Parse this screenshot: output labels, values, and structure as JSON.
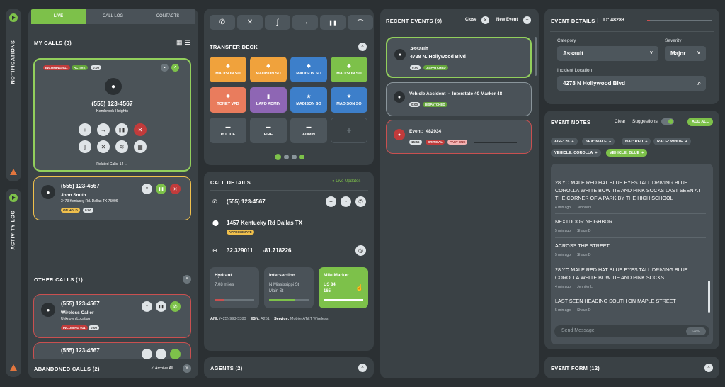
{
  "rails": {
    "notifications": "NOTIFICATIONS",
    "activity": "ACTIVITY LOG"
  },
  "calls": {
    "tabs": [
      "LIVE",
      "CALL LOG",
      "CONTACTS"
    ],
    "my_calls": "MY CALLS",
    "my_count": "(3)",
    "active": {
      "badges": [
        "INCOMING 911",
        "ACTIVE",
        "0:00"
      ],
      "phone": "(555) 123-4567",
      "location": "Kembrook Heights",
      "related": "Related Calls: 14"
    },
    "hold": {
      "phone": "(555) 123-4567",
      "name": "John Smith",
      "address": "3473 Kentucky Rd. Dallas TX 75006",
      "badges": [
        "ON HOLD",
        "0:00"
      ]
    },
    "other_calls": "OTHER CALLS",
    "other_count": "(1)",
    "other": {
      "phone": "(555) 123-4567",
      "name": "Wireless Caller",
      "location": "Unknown Location",
      "badges": [
        "INCOMING 911",
        "0:00"
      ]
    },
    "partial_phone": "(555) 123-4567",
    "abandoned": "ABANDONED CALLS",
    "abandoned_count": "(2)",
    "archive": "Archive All"
  },
  "transfer": {
    "title": "TRANSFER DECK",
    "tiles": [
      {
        "label": "MADISON SO",
        "color": "#f0a23c",
        "icon": "◆"
      },
      {
        "label": "MADISON SO",
        "color": "#f0a23c",
        "icon": "◆"
      },
      {
        "label": "MADISON SO",
        "color": "#3d7fca",
        "icon": "◆"
      },
      {
        "label": "MADISON SO",
        "color": "#7dc14a",
        "icon": "◆"
      },
      {
        "label": "TONEY VFD",
        "color": "#e97c5d",
        "icon": "✹"
      },
      {
        "label": "LAPD ADMIN",
        "color": "#8e66b4",
        "icon": "▮"
      },
      {
        "label": "MADISON SO",
        "color": "#3d7fca",
        "icon": "★"
      },
      {
        "label": "MADISON SO",
        "color": "#3d7fca",
        "icon": "★"
      },
      {
        "label": "POLICE",
        "color": "#4d565c",
        "icon": "▬"
      },
      {
        "label": "FIRE",
        "color": "#4d565c",
        "icon": "▬"
      },
      {
        "label": "ADMIN",
        "color": "#4d565c",
        "icon": "▬"
      },
      {
        "label": "",
        "color": "#3a4145",
        "icon": "+"
      }
    ]
  },
  "details": {
    "title": "CALL DETAILS",
    "live": "Live Updates",
    "phone": "(555) 123-4567",
    "address": "1457 Kentucky Rd Dallas TX",
    "approx": "APPROXIMATE",
    "lat": "32.329011",
    "lon": "-81.718226",
    "cards": [
      {
        "title": "Hydrant",
        "line1": "7.08 miles",
        "line2": ""
      },
      {
        "title": "Intersection",
        "line1": "N Mississippi St",
        "line2": "Main St"
      },
      {
        "title": "Mile Marker",
        "line1": "US 84",
        "line2": "165"
      }
    ],
    "ani_l": "ANI:",
    "ani": "(425) 993-5380",
    "esn_l": "ESN:",
    "esn": "A251",
    "svc_l": "Service:",
    "svc": "Mobile AT&T Wireless"
  },
  "agents": {
    "title": "AGENTS",
    "count": "(2)"
  },
  "events": {
    "title": "RECENT EVENTS",
    "count": "(9)",
    "close": "Close",
    "new": "New Event",
    "items": [
      {
        "l1": "Assault",
        "l2": "4728 N. Hollywood Blvd",
        "badges": [
          "0:00",
          "DISPATCHED"
        ]
      },
      {
        "l1": "Vehicle Accident  -  Interstate 40 Marker 48",
        "l2": "",
        "badges": [
          "0:00",
          "DISPATCHED"
        ]
      },
      {
        "l1": "Event:  482934",
        "l2": "",
        "badges": [
          "15:56",
          "CRITICAL",
          "PAST DUE"
        ]
      }
    ]
  },
  "event_details": {
    "title": "EVENT DETAILS",
    "id": "ID: 48283",
    "cat_l": "Category",
    "cat": "Assault",
    "sev_l": "Severity",
    "sev": "Major",
    "loc_l": "Incident Location",
    "loc": "4278 N Hollywood Blvd"
  },
  "notes": {
    "title": "EVENT NOTES",
    "clear": "Clear",
    "suggest": "Suggestions",
    "addall": "ADD ALL",
    "tags": [
      "AGE: 26",
      "SEX: MALE",
      "HAT: RED",
      "RACE: WHITE",
      "VEHICLE: COROLLA",
      "VEHICLE: BLUE"
    ],
    "items": [
      {
        "text": "28 YO MALE RED HAT BLUE EYES TALL DRIVING BLUE COROLLA WHITE BOW TIE AND PINK SOCKS LAST SEEN AT THE CORNER OF A PARK BY THE HIGH SCHOOL",
        "time": "4 min ago",
        "who": "Jennifer L"
      },
      {
        "text": "NEXTDOOR NEIGHBOR",
        "time": "5 min ago",
        "who": "Shaun D"
      },
      {
        "text": "ACROSS THE STREET",
        "time": "5 min ago",
        "who": "Shaun D"
      },
      {
        "text": "28 YO MALE RED HAT BLUE EYES TALL DRIVING BLUE COROLLA WHITE BOW TIE AND PINK SOCKS",
        "time": "4 min ago",
        "who": "Jennifer L"
      },
      {
        "text": "LAST SEEN HEADING SOUTH ON MAPLE STREET",
        "time": "5 min ago",
        "who": "Shaun D"
      }
    ],
    "placeholder": "Send Message",
    "save": "SAVE"
  },
  "event_form": {
    "title": "EVENT FORM",
    "count": "(12)"
  }
}
